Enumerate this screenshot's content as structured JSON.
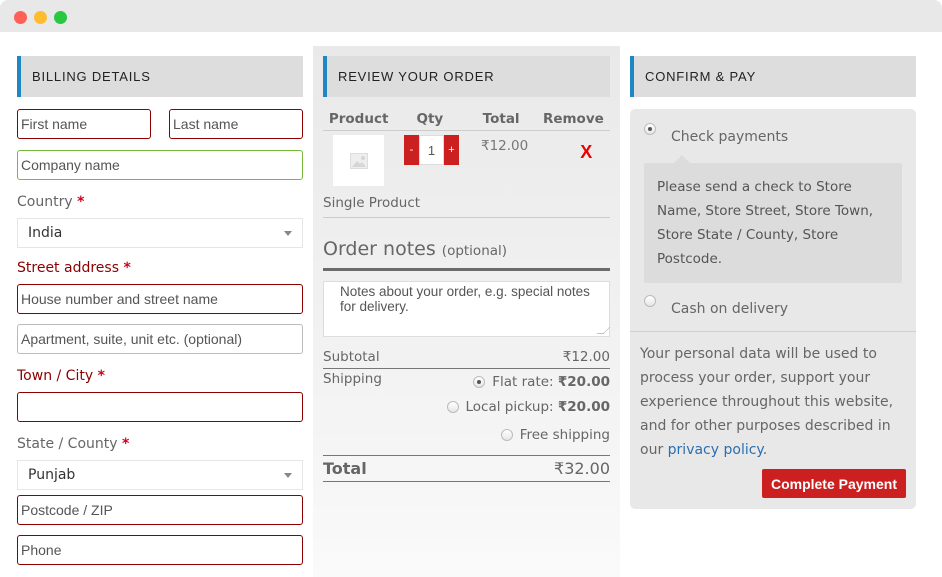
{
  "window": {
    "controls": [
      "close",
      "minimize",
      "maximize"
    ]
  },
  "billing": {
    "title": "BILLING DETAILS",
    "first_name_placeholder": "First name",
    "last_name_placeholder": "Last name",
    "company_placeholder": "Company name",
    "country_label": "Country",
    "country_value": "India",
    "street_label": "Street address",
    "street_placeholder": "House number and street name",
    "apartment_placeholder": "Apartment, suite, unit etc. (optional)",
    "city_label": "Town / City",
    "city_value": "",
    "state_label": "State / County",
    "state_value": "Punjab",
    "postcode_placeholder": "Postcode / ZIP",
    "phone_placeholder": "Phone",
    "required_mark": "*"
  },
  "review": {
    "title": "REVIEW YOUR ORDER",
    "columns": [
      "Product",
      "Qty",
      "Total",
      "Remove"
    ],
    "items": [
      {
        "name": "Single Product",
        "qty": "1",
        "total": "₹12.00",
        "remove": "X",
        "minus": "-",
        "plus": "+"
      }
    ],
    "notes_title": "Order notes",
    "notes_optional": "(optional)",
    "notes_placeholder": "Notes about your order, e.g. special notes for delivery.",
    "subtotal_label": "Subtotal",
    "subtotal_value": "₹12.00",
    "shipping_label": "Shipping",
    "shipping_options": [
      {
        "label": "Flat rate: ",
        "price": "₹20.00",
        "selected": true
      },
      {
        "label": "Local pickup: ",
        "price": "₹20.00",
        "selected": false
      },
      {
        "label": "Free shipping",
        "price": "",
        "selected": false
      }
    ],
    "total_label": "Total",
    "total_value": "₹32.00"
  },
  "confirm": {
    "title": "CONFIRM & PAY",
    "payment_methods": [
      {
        "label": "Check payments",
        "selected": true
      },
      {
        "label": "Cash on delivery",
        "selected": false
      }
    ],
    "check_description": "Please send a check to Store Name, Store Street, Store Town, Store State / County, Store Postcode.",
    "privacy_text": "Your personal data will be used to process your order, support your experience throughout this website, and for other purposes described in our ",
    "privacy_link": "privacy policy",
    "privacy_end": ".",
    "button_label": "Complete Payment"
  },
  "colors": {
    "accent_blue": "#1e88c7",
    "button_red": "#cc1f1f",
    "invalid_border": "#8b0000",
    "valid_border": "#7ab83a",
    "link": "#2a6fb0"
  }
}
